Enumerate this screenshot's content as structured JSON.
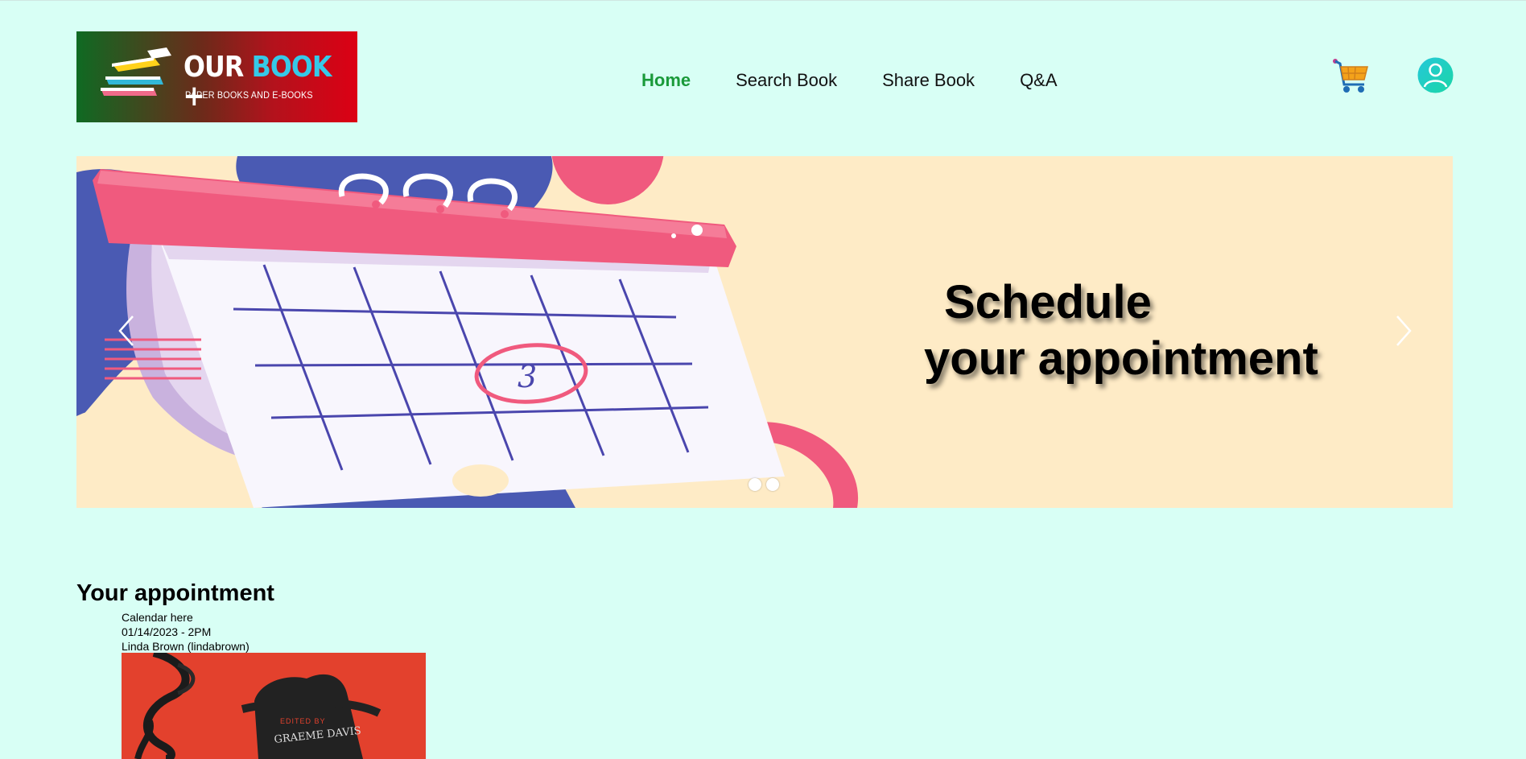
{
  "header": {
    "logo": {
      "brand_part1": "OUR ",
      "brand_part2": "BOOK",
      "brand_part3": " +",
      "tagline": "PAPER BOOKS AND E-BOOKS"
    },
    "nav": [
      {
        "label": "Home",
        "active": true
      },
      {
        "label": "Search Book",
        "active": false
      },
      {
        "label": "Share Book",
        "active": false
      },
      {
        "label": "Q&A",
        "active": false
      }
    ],
    "icons": {
      "cart": "cart-icon",
      "user": "user-account-icon"
    }
  },
  "carousel": {
    "headline_line1": "Schedule",
    "headline_line2": "your appointment",
    "calendar_circled_number": "3",
    "slide_count": 2,
    "prev_icon": "chevron-left-icon",
    "next_icon": "chevron-right-icon"
  },
  "appointment": {
    "title": "Your appointment",
    "calendar_placeholder": "Calendar here",
    "datetime": "01/14/2023 - 2PM",
    "user": "Linda Brown (lindabrown)",
    "book_cover_text": "EDITED BY",
    "book_cover_author": "GRAEME DAVIS"
  },
  "colors": {
    "page_bg": "#d8fff5",
    "accent_green": "#1a9a3a",
    "banner_bg": "#feebc6",
    "calendar_pink": "#f05a7e",
    "calendar_blue": "#4a5ab3"
  }
}
